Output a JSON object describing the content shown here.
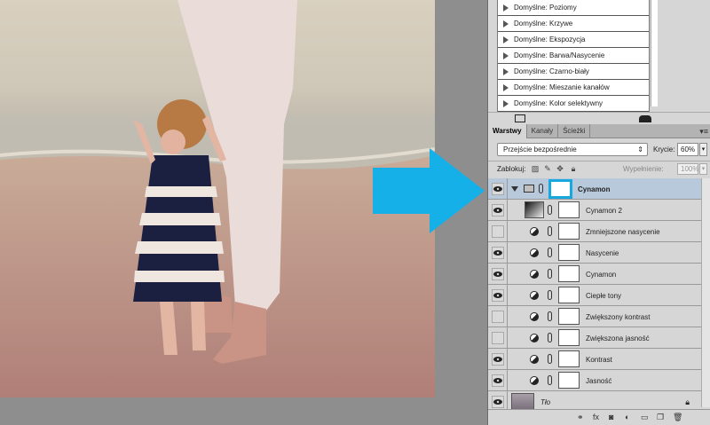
{
  "presets": [
    {
      "label": "Domyślne: Poziomy"
    },
    {
      "label": "Domyślne: Krzywe"
    },
    {
      "label": "Domyślne: Ekspozycja"
    },
    {
      "label": "Domyślne: Barwa/Nasycenie"
    },
    {
      "label": "Domyślne: Czarno-biały"
    },
    {
      "label": "Domyślne: Mieszanie kanałów"
    },
    {
      "label": "Domyślne: Kolor selektywny"
    }
  ],
  "tabs": [
    {
      "label": "Warstwy"
    },
    {
      "label": "Kanały"
    },
    {
      "label": "Ścieżki"
    }
  ],
  "blend": {
    "mode": "Przejście bezpośrednie",
    "opacity_label": "Krycie:",
    "opacity": "60%"
  },
  "lock": {
    "label": "Zablokuj:",
    "fill_label": "Wypełnienie:",
    "fill": "100%"
  },
  "group": {
    "name": "Cynamon"
  },
  "layers": [
    {
      "name": "Cynamon 2",
      "visible": true
    },
    {
      "name": "Zmniejszone nasycenie",
      "visible": false
    },
    {
      "name": "Nasycenie",
      "visible": true
    },
    {
      "name": "Cynamon",
      "visible": true
    },
    {
      "name": "Ciepłe tony",
      "visible": true
    },
    {
      "name": "Zwiększony kontrast",
      "visible": false
    },
    {
      "name": "Zwiększona jasność",
      "visible": false
    },
    {
      "name": "Kontrast",
      "visible": true
    },
    {
      "name": "Jasność",
      "visible": true
    }
  ],
  "background_layer": {
    "name": "Tło"
  },
  "colors": {
    "arrow": "#16b0e8",
    "mask_highlight": "#18a8e0",
    "selected_row": "#b9c9dc"
  }
}
